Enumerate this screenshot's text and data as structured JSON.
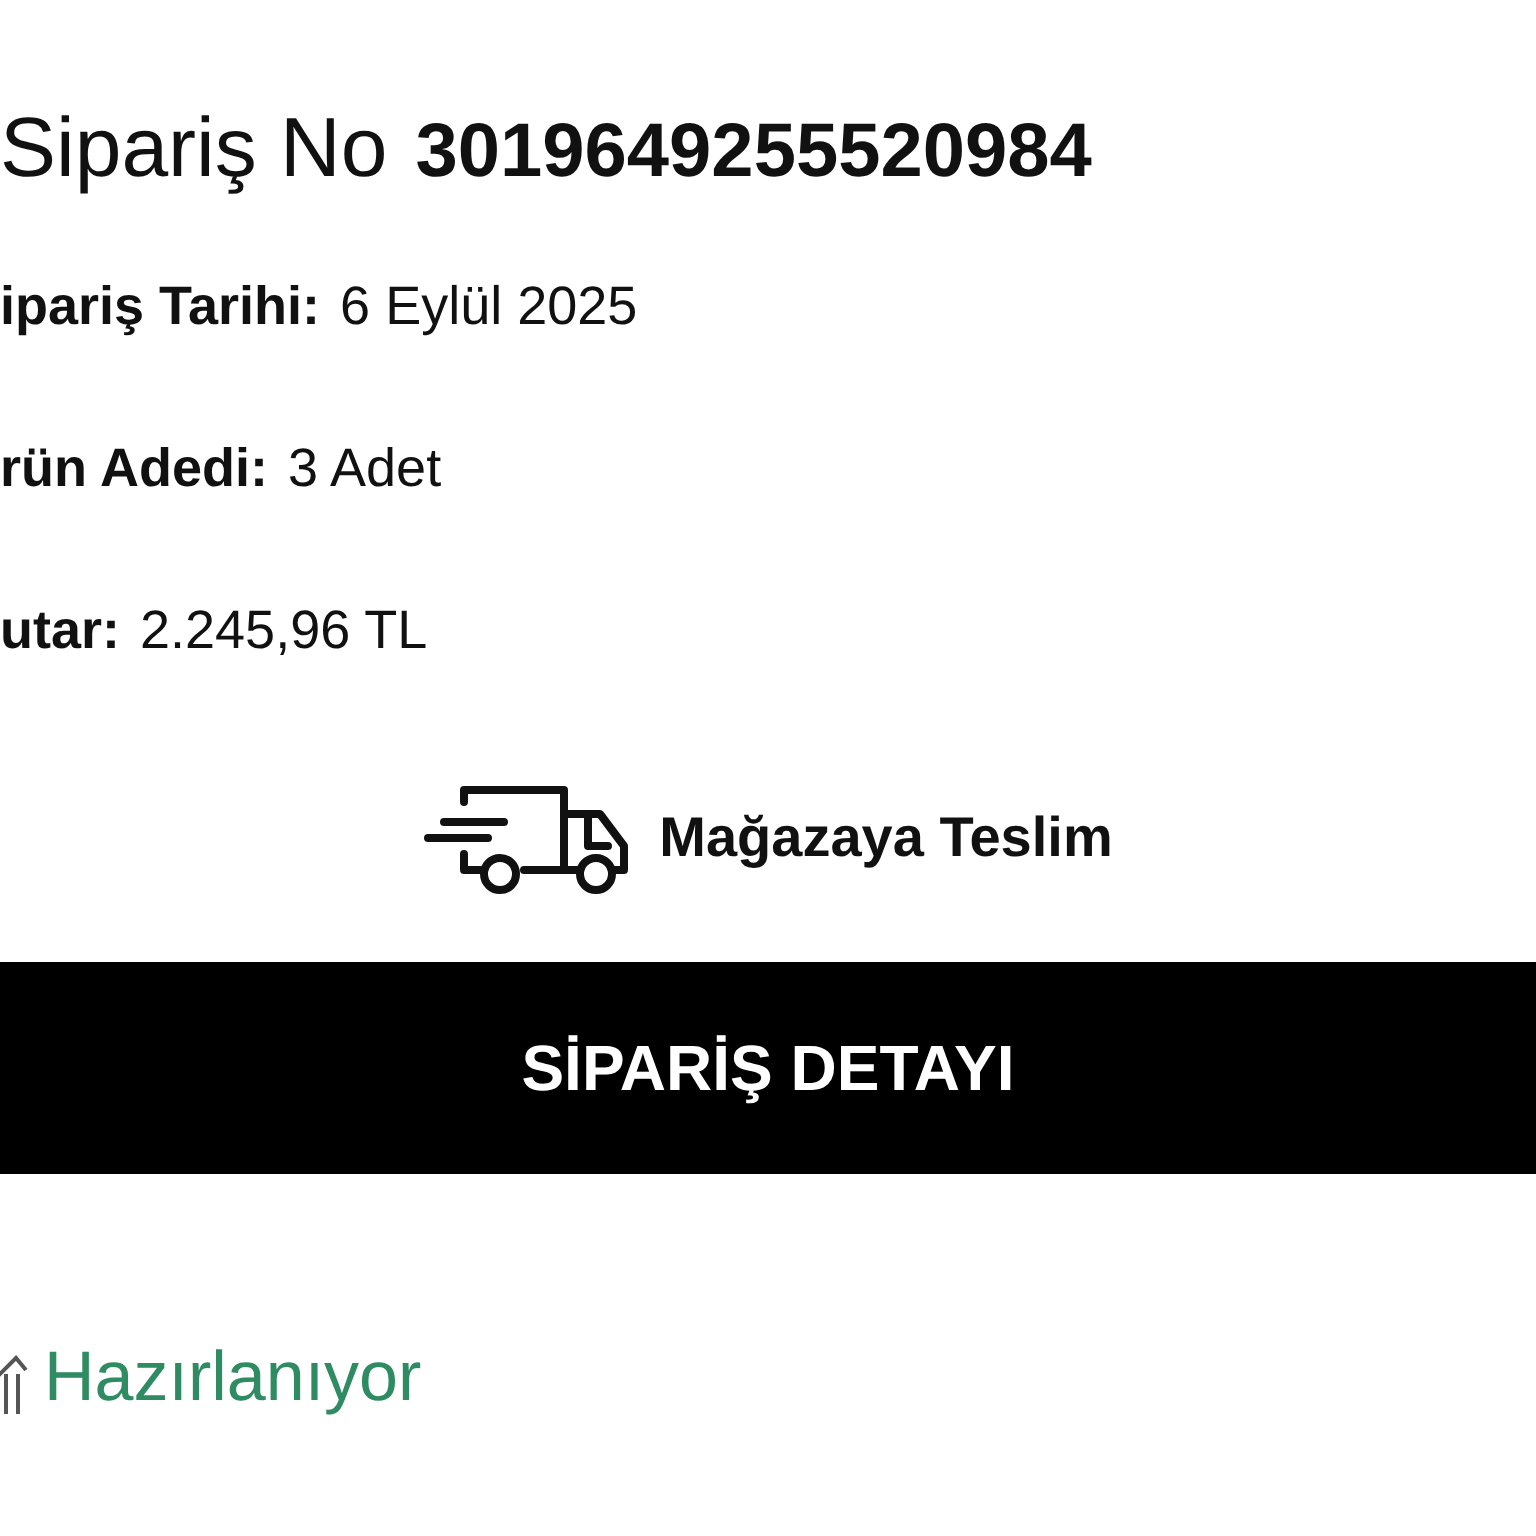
{
  "order": {
    "label": "Sipariş No",
    "number": "3019649255520984"
  },
  "details": [
    {
      "label": "ipariş Tarihi:",
      "value": "6 Eylül 2025"
    },
    {
      "label": "rün Adedi:",
      "value": "3 Adet"
    },
    {
      "label": "utar:",
      "value": "2.245,96 TL"
    }
  ],
  "delivery": {
    "label": "Mağazaya Teslim"
  },
  "detail_button": {
    "label": "SİPARİŞ DETAYI"
  },
  "status": {
    "label": "Hazırlanıyor",
    "color": "#2e8b62"
  }
}
